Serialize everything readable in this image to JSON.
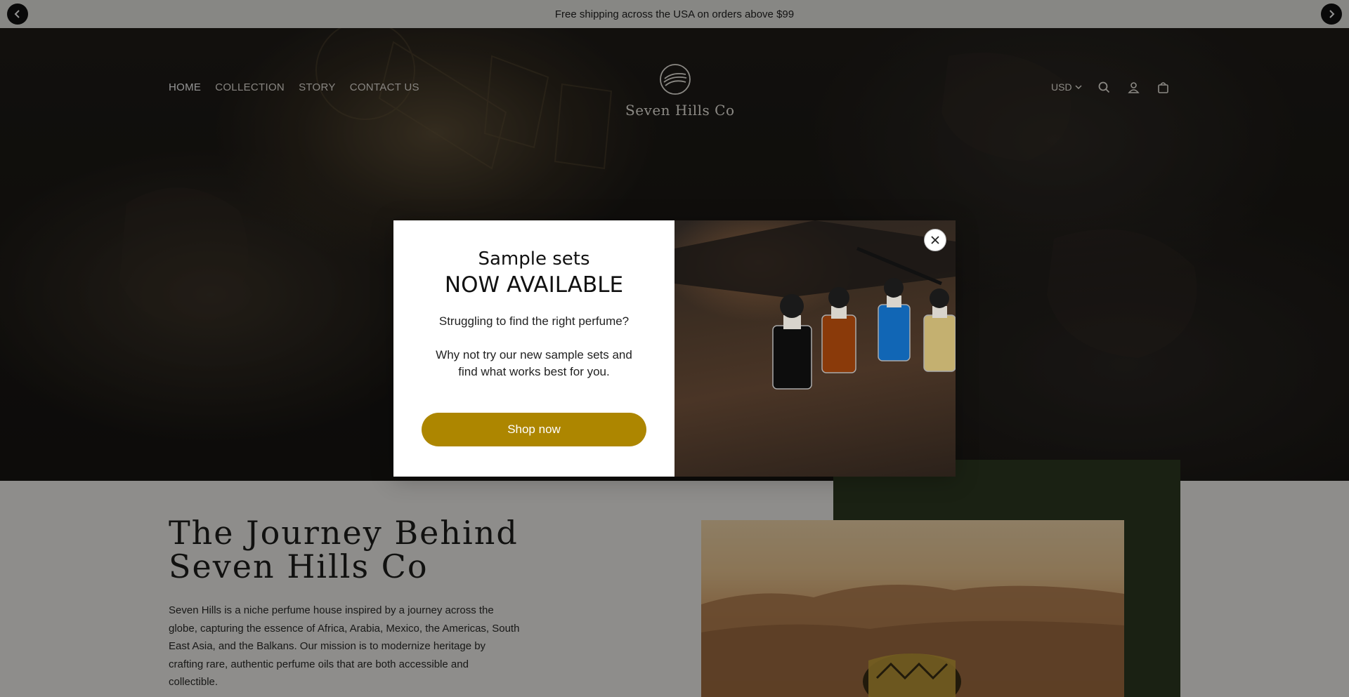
{
  "announcement": {
    "text": "Free shipping across the USA on orders above $99",
    "prev_icon": "chevron-left-icon",
    "next_icon": "chevron-right-icon"
  },
  "header": {
    "nav": [
      {
        "label": "HOME",
        "active": true
      },
      {
        "label": "COLLECTION",
        "active": false
      },
      {
        "label": "STORY",
        "active": false
      },
      {
        "label": "CONTACT US",
        "active": false
      }
    ],
    "logo_text": "Seven Hills Co",
    "currency": "USD",
    "icons": [
      "search-icon",
      "account-icon",
      "cart-icon"
    ]
  },
  "story": {
    "title_line1": "The Journey Behind",
    "title_line2": "Seven Hills Co",
    "paragraph": "Seven Hills is a niche perfume house inspired by a journey across the globe, capturing the essence of Africa, Arabia, Mexico, the Americas, South East Asia, and the Balkans. Our mission is to modernize heritage by crafting rare, authentic perfume oils that are both accessible and collectible."
  },
  "popup": {
    "title_line1": "Sample sets",
    "title_line2": "NOW AVAILABLE",
    "text1": "Struggling to find the right perfume?",
    "text2": "Why not try our new sample sets and find what works best for you.",
    "button_label": "Shop now",
    "close_icon": "close-icon"
  },
  "colors": {
    "accent": "#ad8600",
    "announcement_bg": "#e9e8e3",
    "story_green": "#2d3a22"
  }
}
